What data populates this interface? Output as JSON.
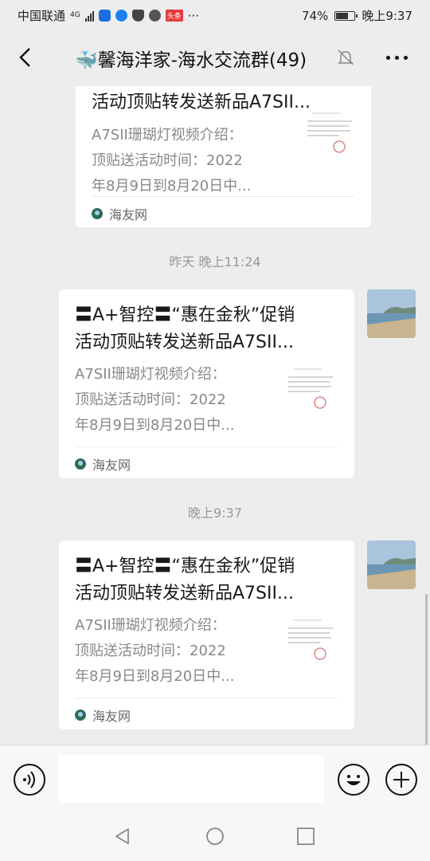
{
  "status_bar": {
    "carrier": "中国联通",
    "network": "4G",
    "notif_badge": "头条",
    "more": "···",
    "battery": "74%",
    "battery_level": 0.74,
    "time": "晚上9:37"
  },
  "header": {
    "title": "🐳馨海洋家-海水交流群(49)"
  },
  "messages": [
    {
      "title_line2": "活动顶贴转发送新品A7SII...",
      "desc": [
        "A7SII珊瑚灯视频介绍：",
        "顶贴送活动时间：2022",
        "年8月9日到8月20日中..."
      ],
      "source": "海友网"
    },
    {
      "timestamp": "昨天 晚上11:24",
      "title_line1": "〓A+智控〓“惠在金秋”促销",
      "title_line2": "活动顶贴转发送新品A7SII...",
      "desc": [
        "A7SII珊瑚灯视频介绍：",
        "顶贴送活动时间：2022",
        "年8月9日到8月20日中..."
      ],
      "source": "海友网"
    },
    {
      "timestamp": "晚上9:37",
      "title_line1": "〓A+智控〓“惠在金秋”促销",
      "title_line2": "活动顶贴转发送新品A7SII...",
      "desc": [
        "A7SII珊瑚灯视频介绍：",
        "顶贴送活动时间：2022",
        "年8月9日到8月20日中..."
      ],
      "source": "海友网"
    }
  ],
  "colors": {
    "background": "#ededed",
    "card": "#ffffff",
    "desc_text": "#888888",
    "timestamp": "#999999"
  }
}
